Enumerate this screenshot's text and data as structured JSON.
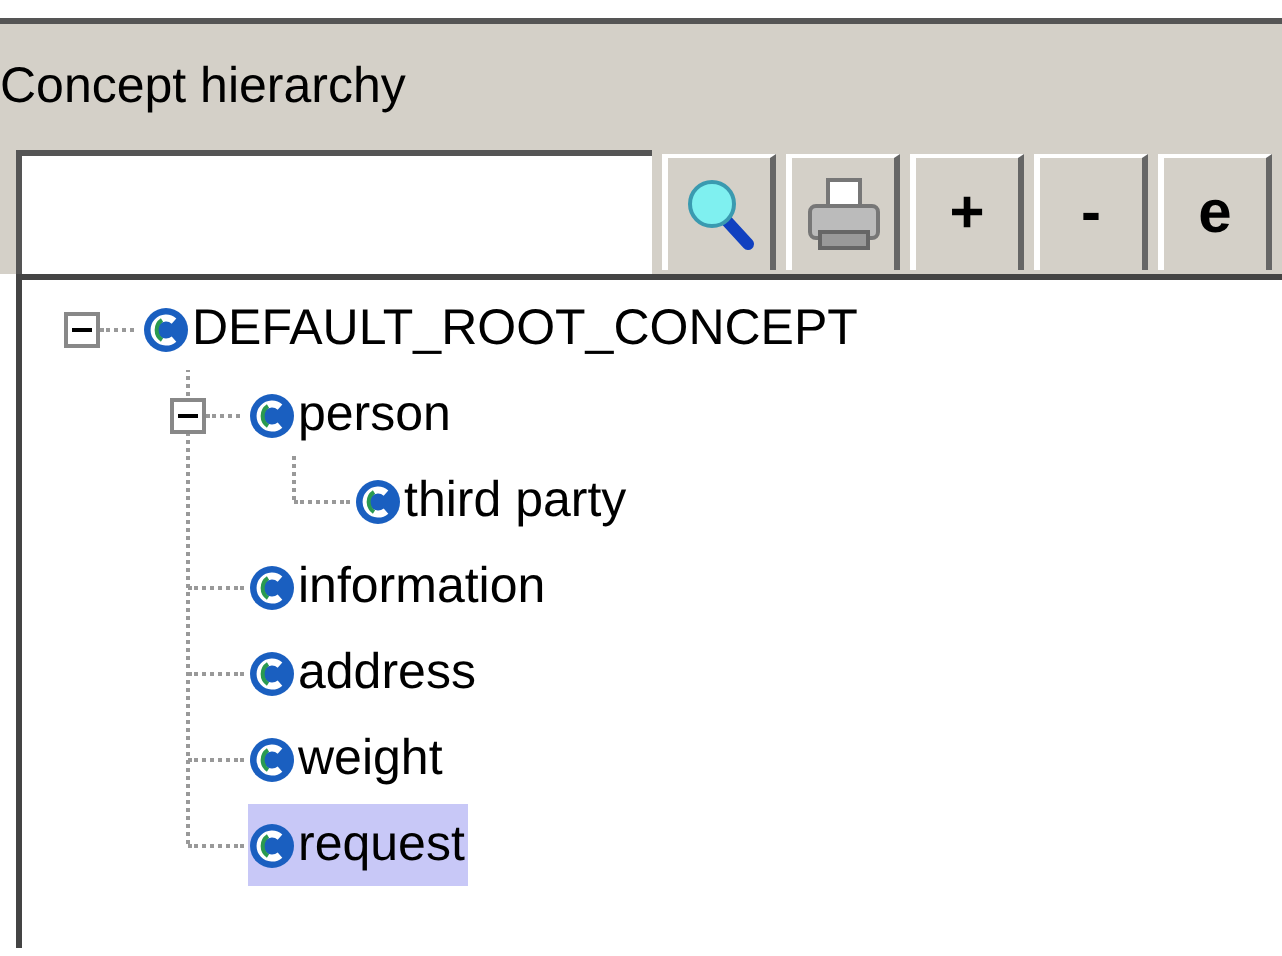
{
  "panel": {
    "title": "Concept hierarchy"
  },
  "toolbar": {
    "buttons": [
      {
        "kind": "search"
      },
      {
        "kind": "print"
      },
      {
        "kind": "text",
        "label": "+"
      },
      {
        "kind": "text",
        "label": "-"
      },
      {
        "kind": "text",
        "label": "e"
      }
    ]
  },
  "tree": [
    {
      "label": "DEFAULT_ROOT_CONCEPT",
      "selected": false,
      "expanded": true,
      "children": [
        {
          "label": "person",
          "selected": false,
          "expanded": true,
          "children": [
            {
              "label": "third party",
              "selected": false
            }
          ]
        },
        {
          "label": "information",
          "selected": false
        },
        {
          "label": "address",
          "selected": false
        },
        {
          "label": "weight",
          "selected": false
        },
        {
          "label": "request",
          "selected": true
        }
      ]
    }
  ]
}
